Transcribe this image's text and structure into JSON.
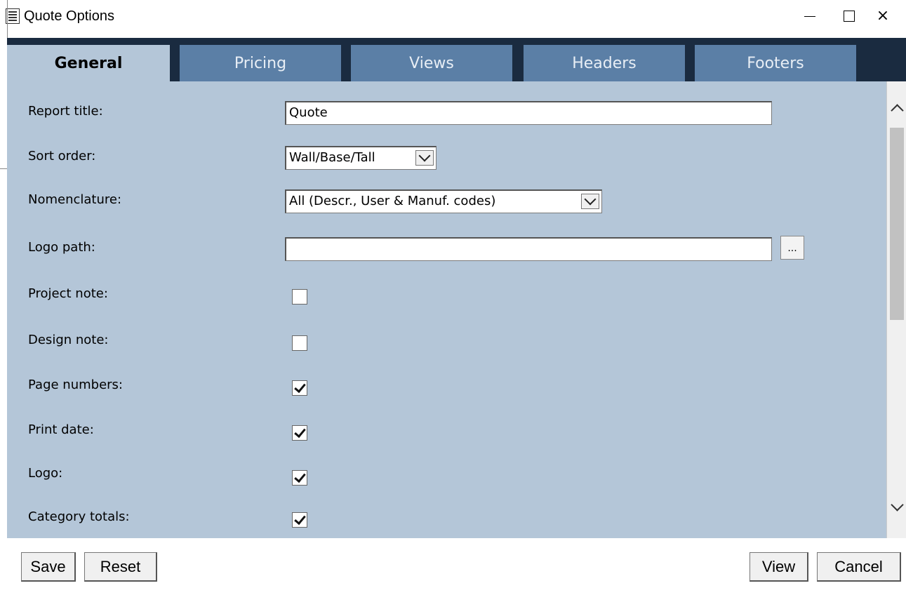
{
  "window": {
    "title": "Quote Options",
    "app_icon": "document-icon",
    "controls": {
      "minimize": "minimize-icon",
      "maximize": "maximize-icon",
      "close": "×"
    }
  },
  "tabs": [
    {
      "label": "General",
      "active": true
    },
    {
      "label": "Pricing",
      "active": false
    },
    {
      "label": "Views",
      "active": false
    },
    {
      "label": "Headers",
      "active": false
    },
    {
      "label": "Footers",
      "active": false
    }
  ],
  "form": {
    "report_title": {
      "label": "Report title:",
      "value": "Quote"
    },
    "sort_order": {
      "label": "Sort order:",
      "value": "Wall/Base/Tall"
    },
    "nomenclature": {
      "label": "Nomenclature:",
      "value": "All (Descr., User & Manuf. codes)"
    },
    "logo_path": {
      "label": "Logo path:",
      "value": "",
      "browse_label": "..."
    },
    "project_note": {
      "label": "Project note:",
      "checked": false
    },
    "design_note": {
      "label": "Design note:",
      "checked": false
    },
    "page_numbers": {
      "label": "Page numbers:",
      "checked": true
    },
    "print_date": {
      "label": "Print date:",
      "checked": true
    },
    "logo": {
      "label": "Logo:",
      "checked": true
    },
    "category_totals": {
      "label": "Category totals:",
      "checked": true
    }
  },
  "buttons": {
    "save": "Save",
    "reset": "Reset",
    "view": "View",
    "cancel": "Cancel"
  },
  "colors": {
    "tab_strip": "#1a2b40",
    "tab_inactive": "#5b7fa6",
    "panel": "#b4c6d8"
  }
}
